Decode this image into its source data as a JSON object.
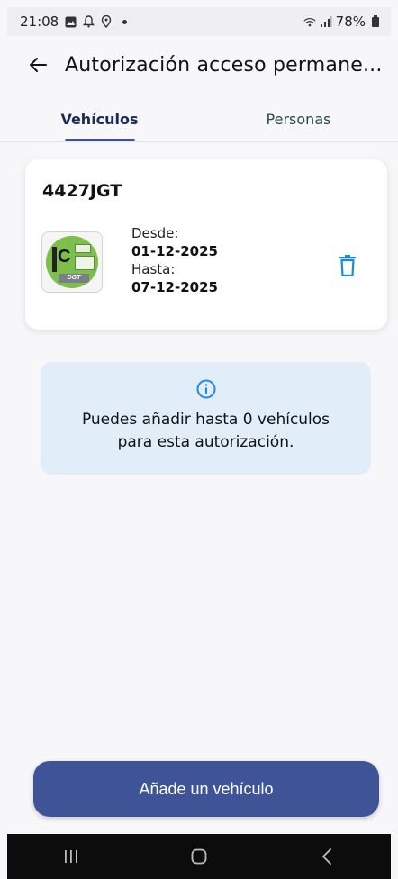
{
  "status_bar": {
    "time": "21:08",
    "battery": "78%",
    "icons": [
      "image-icon",
      "notification-icon",
      "location-icon",
      "dot-icon",
      "wifi-icon",
      "signal-icon",
      "battery-icon"
    ]
  },
  "app_bar": {
    "title": "Autorización acceso permane..."
  },
  "tabs": [
    {
      "label": "Vehículos",
      "selected": true
    },
    {
      "label": "Personas",
      "selected": false
    }
  ],
  "vehicle": {
    "plate": "4427JGT",
    "label_letter": "C",
    "label_brand": "DGT",
    "from_label": "Desde:",
    "from_date": "01-12-2025",
    "to_label": "Hasta:",
    "to_date": "07-12-2025"
  },
  "info": {
    "message": "Puedes añadir hasta 0 vehículos para esta autorización."
  },
  "actions": {
    "add_vehicle": "Añade un vehículo"
  },
  "colors": {
    "primary": "#3f5497",
    "info_bg": "#e1eefa",
    "icon_blue": "#1e88e5",
    "label_green": "#7cc04b"
  }
}
